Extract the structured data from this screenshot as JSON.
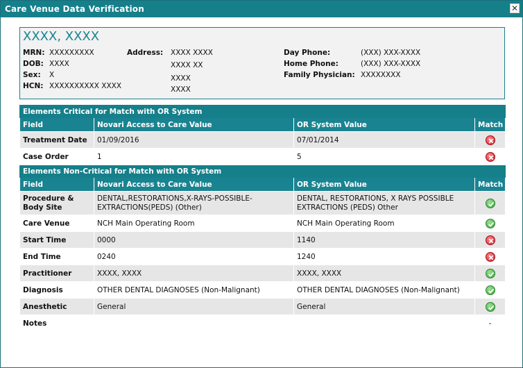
{
  "window": {
    "title": "Care Venue Data Verification",
    "close_glyph": "✕"
  },
  "patient": {
    "name": "XXXX, XXXX",
    "mrn_label": "MRN:",
    "mrn": "XXXXXXXXX",
    "dob_label": "DOB:",
    "dob": "XXXX",
    "sex_label": "Sex:",
    "sex": "X",
    "hcn_label": "HCN:",
    "hcn": "XXXXXXXXXX XXXX",
    "address_label": "Address:",
    "address_lines": [
      "XXXX XXXX",
      "XXXX XX",
      "XXXX",
      "XXXX"
    ],
    "day_phone_label": "Day Phone:",
    "day_phone": "(XXX) XXX-XXXX",
    "home_phone_label": "Home Phone:",
    "home_phone": "(XXX) XXX-XXXX",
    "family_physician_label": "Family Physician:",
    "family_physician": "XXXXXXXX"
  },
  "columns": {
    "field": "Field",
    "novari": "Novari Access to Care Value",
    "or": "OR System Value",
    "match": "Match"
  },
  "critical": {
    "title": "Elements Critical for Match with OR System",
    "rows": [
      {
        "field": "Treatment Date",
        "novari": "01/09/2016",
        "or": "07/01/2014",
        "match": "mismatch"
      },
      {
        "field": "Case Order",
        "novari": "1",
        "or": "5",
        "match": "mismatch"
      }
    ]
  },
  "noncritical": {
    "title": "Elements Non-Critical for Match with OR System",
    "rows": [
      {
        "field": "Procedure & Body Site",
        "novari": "DENTAL,RESTORATIONS,X-RAYS-POSSIBLE-EXTRACTIONS(PEDS) (Other)",
        "or": "DENTAL, RESTORATIONS, X RAYS POSSIBLE EXTRACTIONS (PEDS) Other",
        "match": "match"
      },
      {
        "field": "Care Venue",
        "novari": "NCH Main Operating Room",
        "or": "NCH Main Operating Room",
        "match": "match"
      },
      {
        "field": "Start Time",
        "novari": "0000",
        "or": "1140",
        "match": "mismatch"
      },
      {
        "field": "End Time",
        "novari": "0240",
        "or": "1240",
        "match": "mismatch"
      },
      {
        "field": "Practitioner",
        "novari": "XXXX, XXXX",
        "or": "XXXX, XXXX",
        "match": "match"
      },
      {
        "field": "Diagnosis",
        "novari": "OTHER DENTAL DIAGNOSES (Non-Malignant)",
        "or": "OTHER DENTAL DIAGNOSES (Non-Malignant)",
        "match": "match"
      },
      {
        "field": "Anesthetic",
        "novari": "General",
        "or": "General",
        "match": "match"
      },
      {
        "field": "Notes",
        "novari": "",
        "or": "",
        "match": "-"
      }
    ]
  },
  "icons": {
    "match": "check-circle-icon",
    "mismatch": "x-circle-icon"
  },
  "colors": {
    "teal": "#157f8a",
    "match_green": "#3aa33a",
    "mismatch_red": "#d21e2f"
  }
}
